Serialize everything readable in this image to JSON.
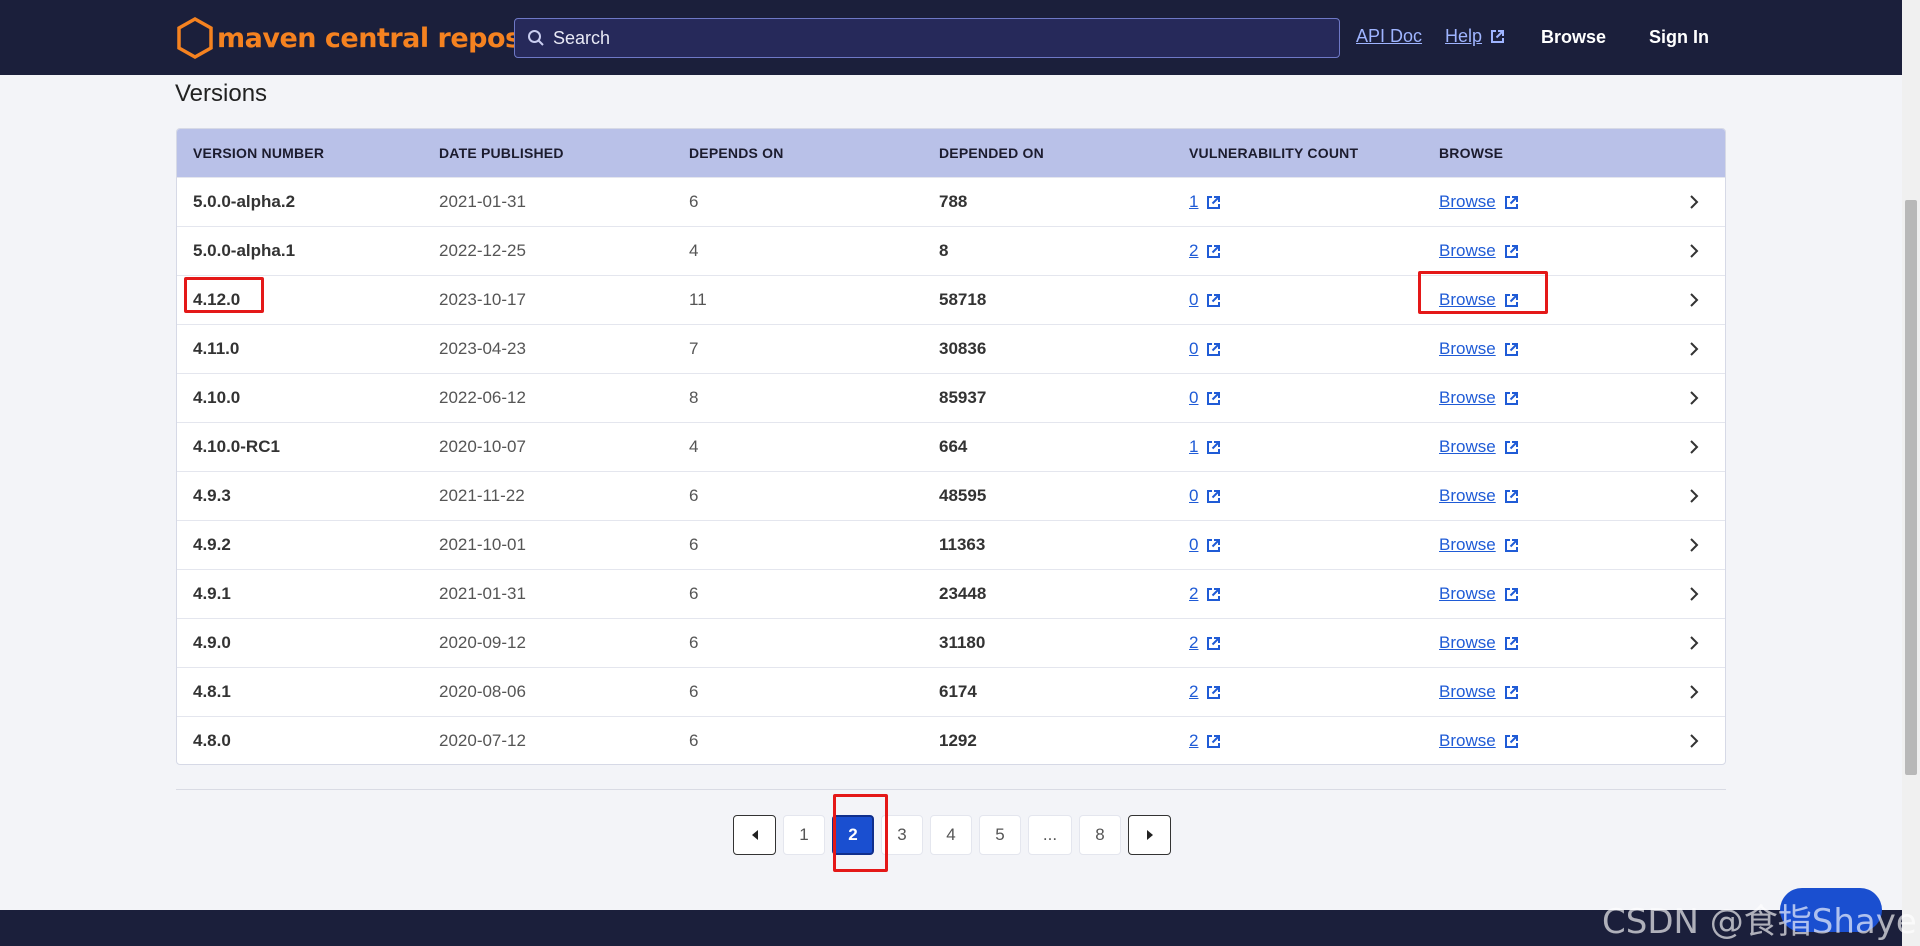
{
  "header": {
    "logo_text": "maven central repository",
    "search_placeholder": "Search",
    "api_doc": "API Doc",
    "help": "Help",
    "browse": "Browse",
    "sign_in": "Sign In"
  },
  "page_title": "Versions",
  "table": {
    "columns": [
      "VERSION NUMBER",
      "DATE PUBLISHED",
      "DEPENDS ON",
      "DEPENDED ON",
      "VULNERABILITY COUNT",
      "BROWSE"
    ],
    "rows": [
      {
        "version": "5.0.0-alpha.2",
        "date": "2021-01-31",
        "depends_on": "6",
        "depended_on": "788",
        "vulns": "1",
        "browse": "Browse"
      },
      {
        "version": "5.0.0-alpha.1",
        "date": "2022-12-25",
        "depends_on": "4",
        "depended_on": "8",
        "vulns": "2",
        "browse": "Browse"
      },
      {
        "version": "4.12.0",
        "date": "2023-10-17",
        "depends_on": "11",
        "depended_on": "58718",
        "vulns": "0",
        "browse": "Browse"
      },
      {
        "version": "4.11.0",
        "date": "2023-04-23",
        "depends_on": "7",
        "depended_on": "30836",
        "vulns": "0",
        "browse": "Browse"
      },
      {
        "version": "4.10.0",
        "date": "2022-06-12",
        "depends_on": "8",
        "depended_on": "85937",
        "vulns": "0",
        "browse": "Browse"
      },
      {
        "version": "4.10.0-RC1",
        "date": "2020-10-07",
        "depends_on": "4",
        "depended_on": "664",
        "vulns": "1",
        "browse": "Browse"
      },
      {
        "version": "4.9.3",
        "date": "2021-11-22",
        "depends_on": "6",
        "depended_on": "48595",
        "vulns": "0",
        "browse": "Browse"
      },
      {
        "version": "4.9.2",
        "date": "2021-10-01",
        "depends_on": "6",
        "depended_on": "11363",
        "vulns": "0",
        "browse": "Browse"
      },
      {
        "version": "4.9.1",
        "date": "2021-01-31",
        "depends_on": "6",
        "depended_on": "23448",
        "vulns": "2",
        "browse": "Browse"
      },
      {
        "version": "4.9.0",
        "date": "2020-09-12",
        "depends_on": "6",
        "depended_on": "31180",
        "vulns": "2",
        "browse": "Browse"
      },
      {
        "version": "4.8.1",
        "date": "2020-08-06",
        "depends_on": "6",
        "depended_on": "6174",
        "vulns": "2",
        "browse": "Browse"
      },
      {
        "version": "4.8.0",
        "date": "2020-07-12",
        "depends_on": "6",
        "depended_on": "1292",
        "vulns": "2",
        "browse": "Browse"
      }
    ]
  },
  "pagination": {
    "pages": [
      "1",
      "2",
      "3",
      "4",
      "5",
      "...",
      "8"
    ],
    "current": "2"
  },
  "watermark": "CSDN @食指Shaye",
  "colors": {
    "header_bg": "#1b1f3b",
    "brand_orange": "#f58220",
    "table_header_bg": "#b9c1e8",
    "link": "#1f5bd6",
    "active_page": "#1a4fd0",
    "highlight": "#e41818"
  }
}
